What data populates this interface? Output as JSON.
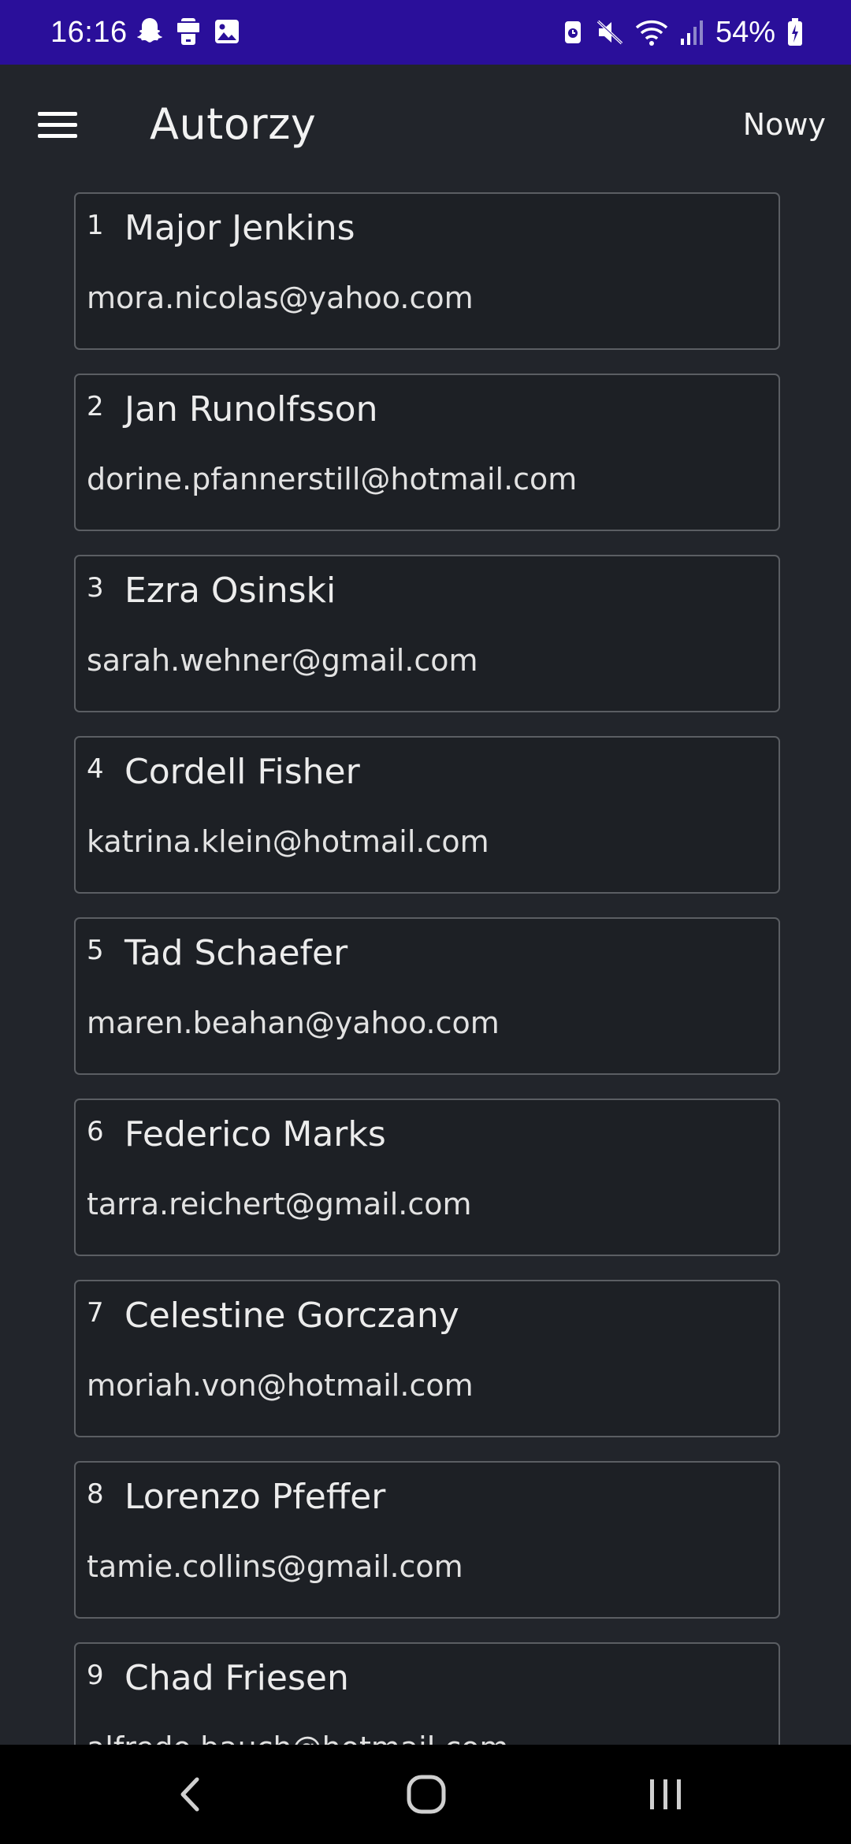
{
  "status_bar": {
    "time": "16:16",
    "battery": "54%",
    "left_icons": [
      "snapchat-icon",
      "phone-notification-icon",
      "gallery-icon"
    ],
    "right_icons": [
      "alarm-icon",
      "mute-icon",
      "wifi-icon",
      "signal-icon",
      "battery-charging-icon"
    ]
  },
  "app_bar": {
    "title": "Autorzy",
    "new_label": "Nowy",
    "menu_icon": "hamburger-menu-icon"
  },
  "authors": [
    {
      "number": "1",
      "name": "Major Jenkins",
      "email": "mora.nicolas@yahoo.com"
    },
    {
      "number": "2",
      "name": "Jan Runolfsson",
      "email": "dorine.pfannerstill@hotmail.com"
    },
    {
      "number": "3",
      "name": "Ezra Osinski",
      "email": "sarah.wehner@gmail.com"
    },
    {
      "number": "4",
      "name": "Cordell Fisher",
      "email": "katrina.klein@hotmail.com"
    },
    {
      "number": "5",
      "name": "Tad Schaefer",
      "email": "maren.beahan@yahoo.com"
    },
    {
      "number": "6",
      "name": "Federico Marks",
      "email": "tarra.reichert@gmail.com"
    },
    {
      "number": "7",
      "name": "Celestine Gorczany",
      "email": "moriah.von@hotmail.com"
    },
    {
      "number": "8",
      "name": "Lorenzo Pfeffer",
      "email": "tamie.collins@gmail.com"
    },
    {
      "number": "9",
      "name": "Chad Friesen",
      "email": "alfredo.bauch@hotmail.com"
    }
  ],
  "nav_bar": {
    "icons": [
      "back-icon",
      "home-icon",
      "recents-icon"
    ]
  },
  "colors": {
    "status_bar": "#2a0f9a",
    "background": "#22252b",
    "card_background": "#1d2025",
    "card_border": "#5b5e63",
    "nav_bar": "#000000"
  }
}
